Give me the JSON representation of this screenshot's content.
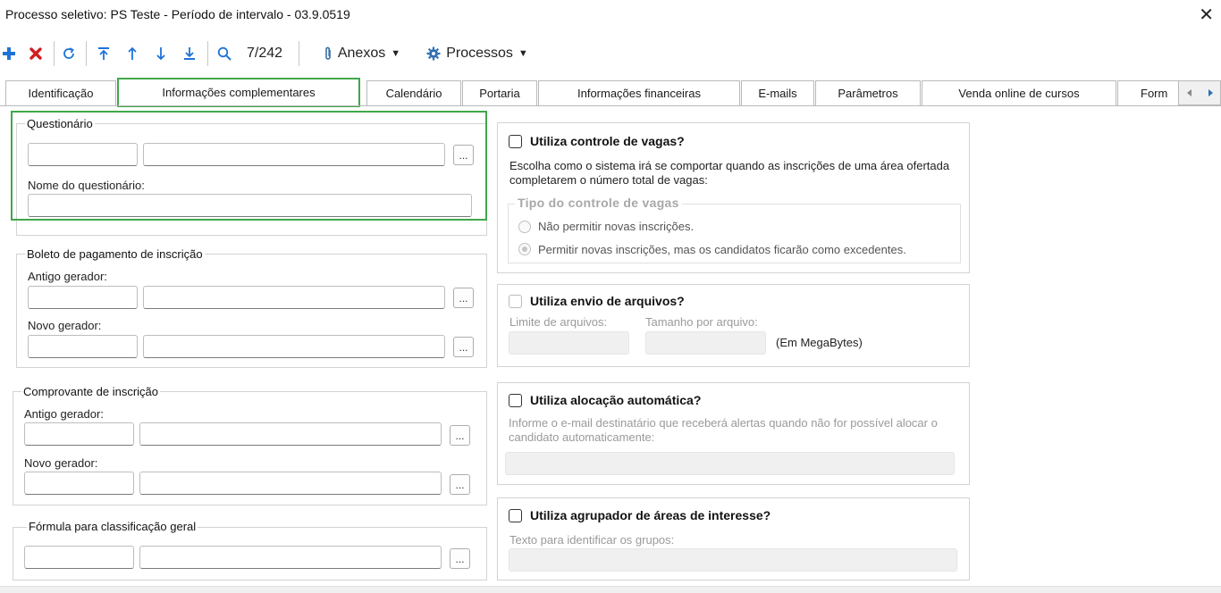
{
  "window": {
    "title": "Processo seletivo: PS Teste - Período de intervalo - 03.9.0519",
    "close_glyph": "✕"
  },
  "toolbar": {
    "icons": [
      "add-icon",
      "delete-icon",
      "refresh-icon",
      "first-record-icon",
      "previous-record-icon",
      "next-record-icon",
      "last-record-icon",
      "search-icon"
    ],
    "record_counter": "7/242",
    "attachments_label": "Anexos",
    "processes_label": "Processos",
    "dropdown_glyph": "▼",
    "colors": {
      "add": "#1e73d8",
      "delete": "#d21e1e",
      "nav": "#1e73d8"
    }
  },
  "tabs": [
    {
      "label": "Identificação"
    },
    {
      "label": "Informações complementares",
      "active": true
    },
    {
      "label": "Calendário"
    },
    {
      "label": "Portaria"
    },
    {
      "label": "Informações financeiras"
    },
    {
      "label": "E-mails"
    },
    {
      "label": "Parâmetros"
    },
    {
      "label": "Venda online de cursos"
    },
    {
      "label": "Form"
    }
  ],
  "questionario": {
    "legend": "Questionário",
    "code_value": "",
    "desc_value": "",
    "name_label": "Nome do questionário:",
    "name_value": ""
  },
  "boleto": {
    "legend": "Boleto de pagamento de inscrição",
    "old_label": "Antigo gerador:",
    "new_label": "Novo gerador:"
  },
  "comprovante": {
    "legend": "Comprovante de inscrição",
    "old_label": "Antigo gerador:",
    "new_label": "Novo gerador:"
  },
  "formula": {
    "legend": "Fórmula para classificação geral"
  },
  "ellipsis": "...",
  "vagas": {
    "title": "Utiliza controle de vagas?",
    "checked": false,
    "description": "Escolha como o sistema irá se comportar quando as inscrições de uma área ofertada completarem o número total de vagas:",
    "type_legend": "Tipo do controle de vagas",
    "options": [
      {
        "label": "Não permitir novas inscrições.",
        "selected": false
      },
      {
        "label": "Permitir novas inscrições, mas os candidatos ficarão como excedentes.",
        "selected": true
      }
    ]
  },
  "arquivos": {
    "title": "Utiliza envio de arquivos?",
    "checked": false,
    "limit_label": "Limite de arquivos:",
    "size_label": "Tamanho por arquivo:",
    "unit": "(Em MegaBytes)"
  },
  "alocacao": {
    "title": "Utiliza alocação automática?",
    "checked": false,
    "description": "Informe o e-mail destinatário que receberá alertas quando não for possível alocar o candidato automaticamente:"
  },
  "agrupador": {
    "title": "Utiliza agrupador de áreas de interesse?",
    "checked": false,
    "text_label": "Texto para identificar os grupos:"
  },
  "highlight_color": "#3fa84a"
}
